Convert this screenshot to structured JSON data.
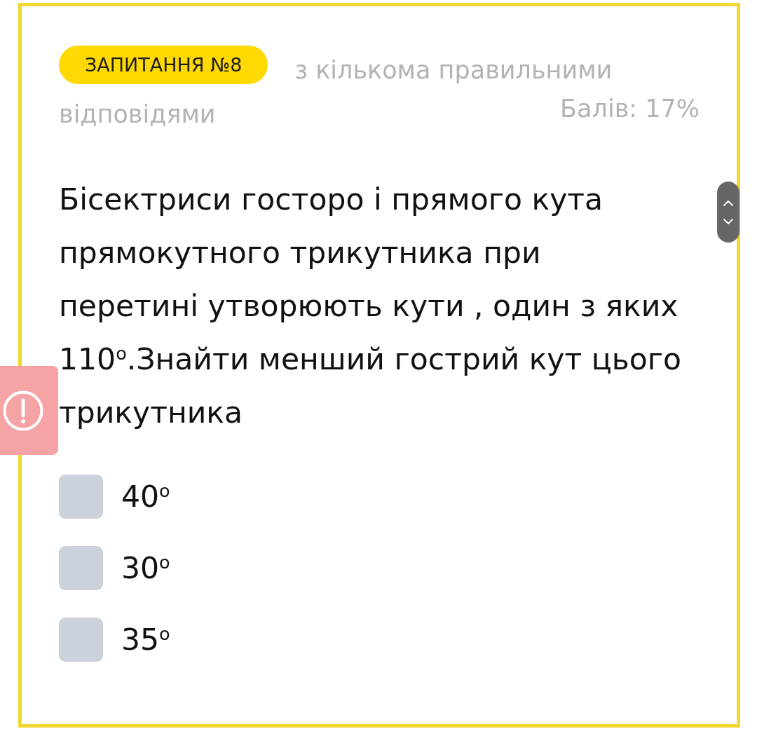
{
  "question": {
    "badge": "ЗАПИТАННЯ №8",
    "type_label_lines": [
      "з кількома правильними",
      "відповідями"
    ],
    "score": "Балів: 17%",
    "text": "Бісектриси госторо і прямого кута прямокутного трикутника при перетині утворюють кути , один з яких 110$^{о}$.Знайти менший гострий кут цього трикутника"
  },
  "options": [
    {
      "label": "40$^{о}$",
      "checked": false
    },
    {
      "label": "30$^{о}$",
      "checked": false
    },
    {
      "label": "35$^{о}$",
      "checked": false
    }
  ]
}
